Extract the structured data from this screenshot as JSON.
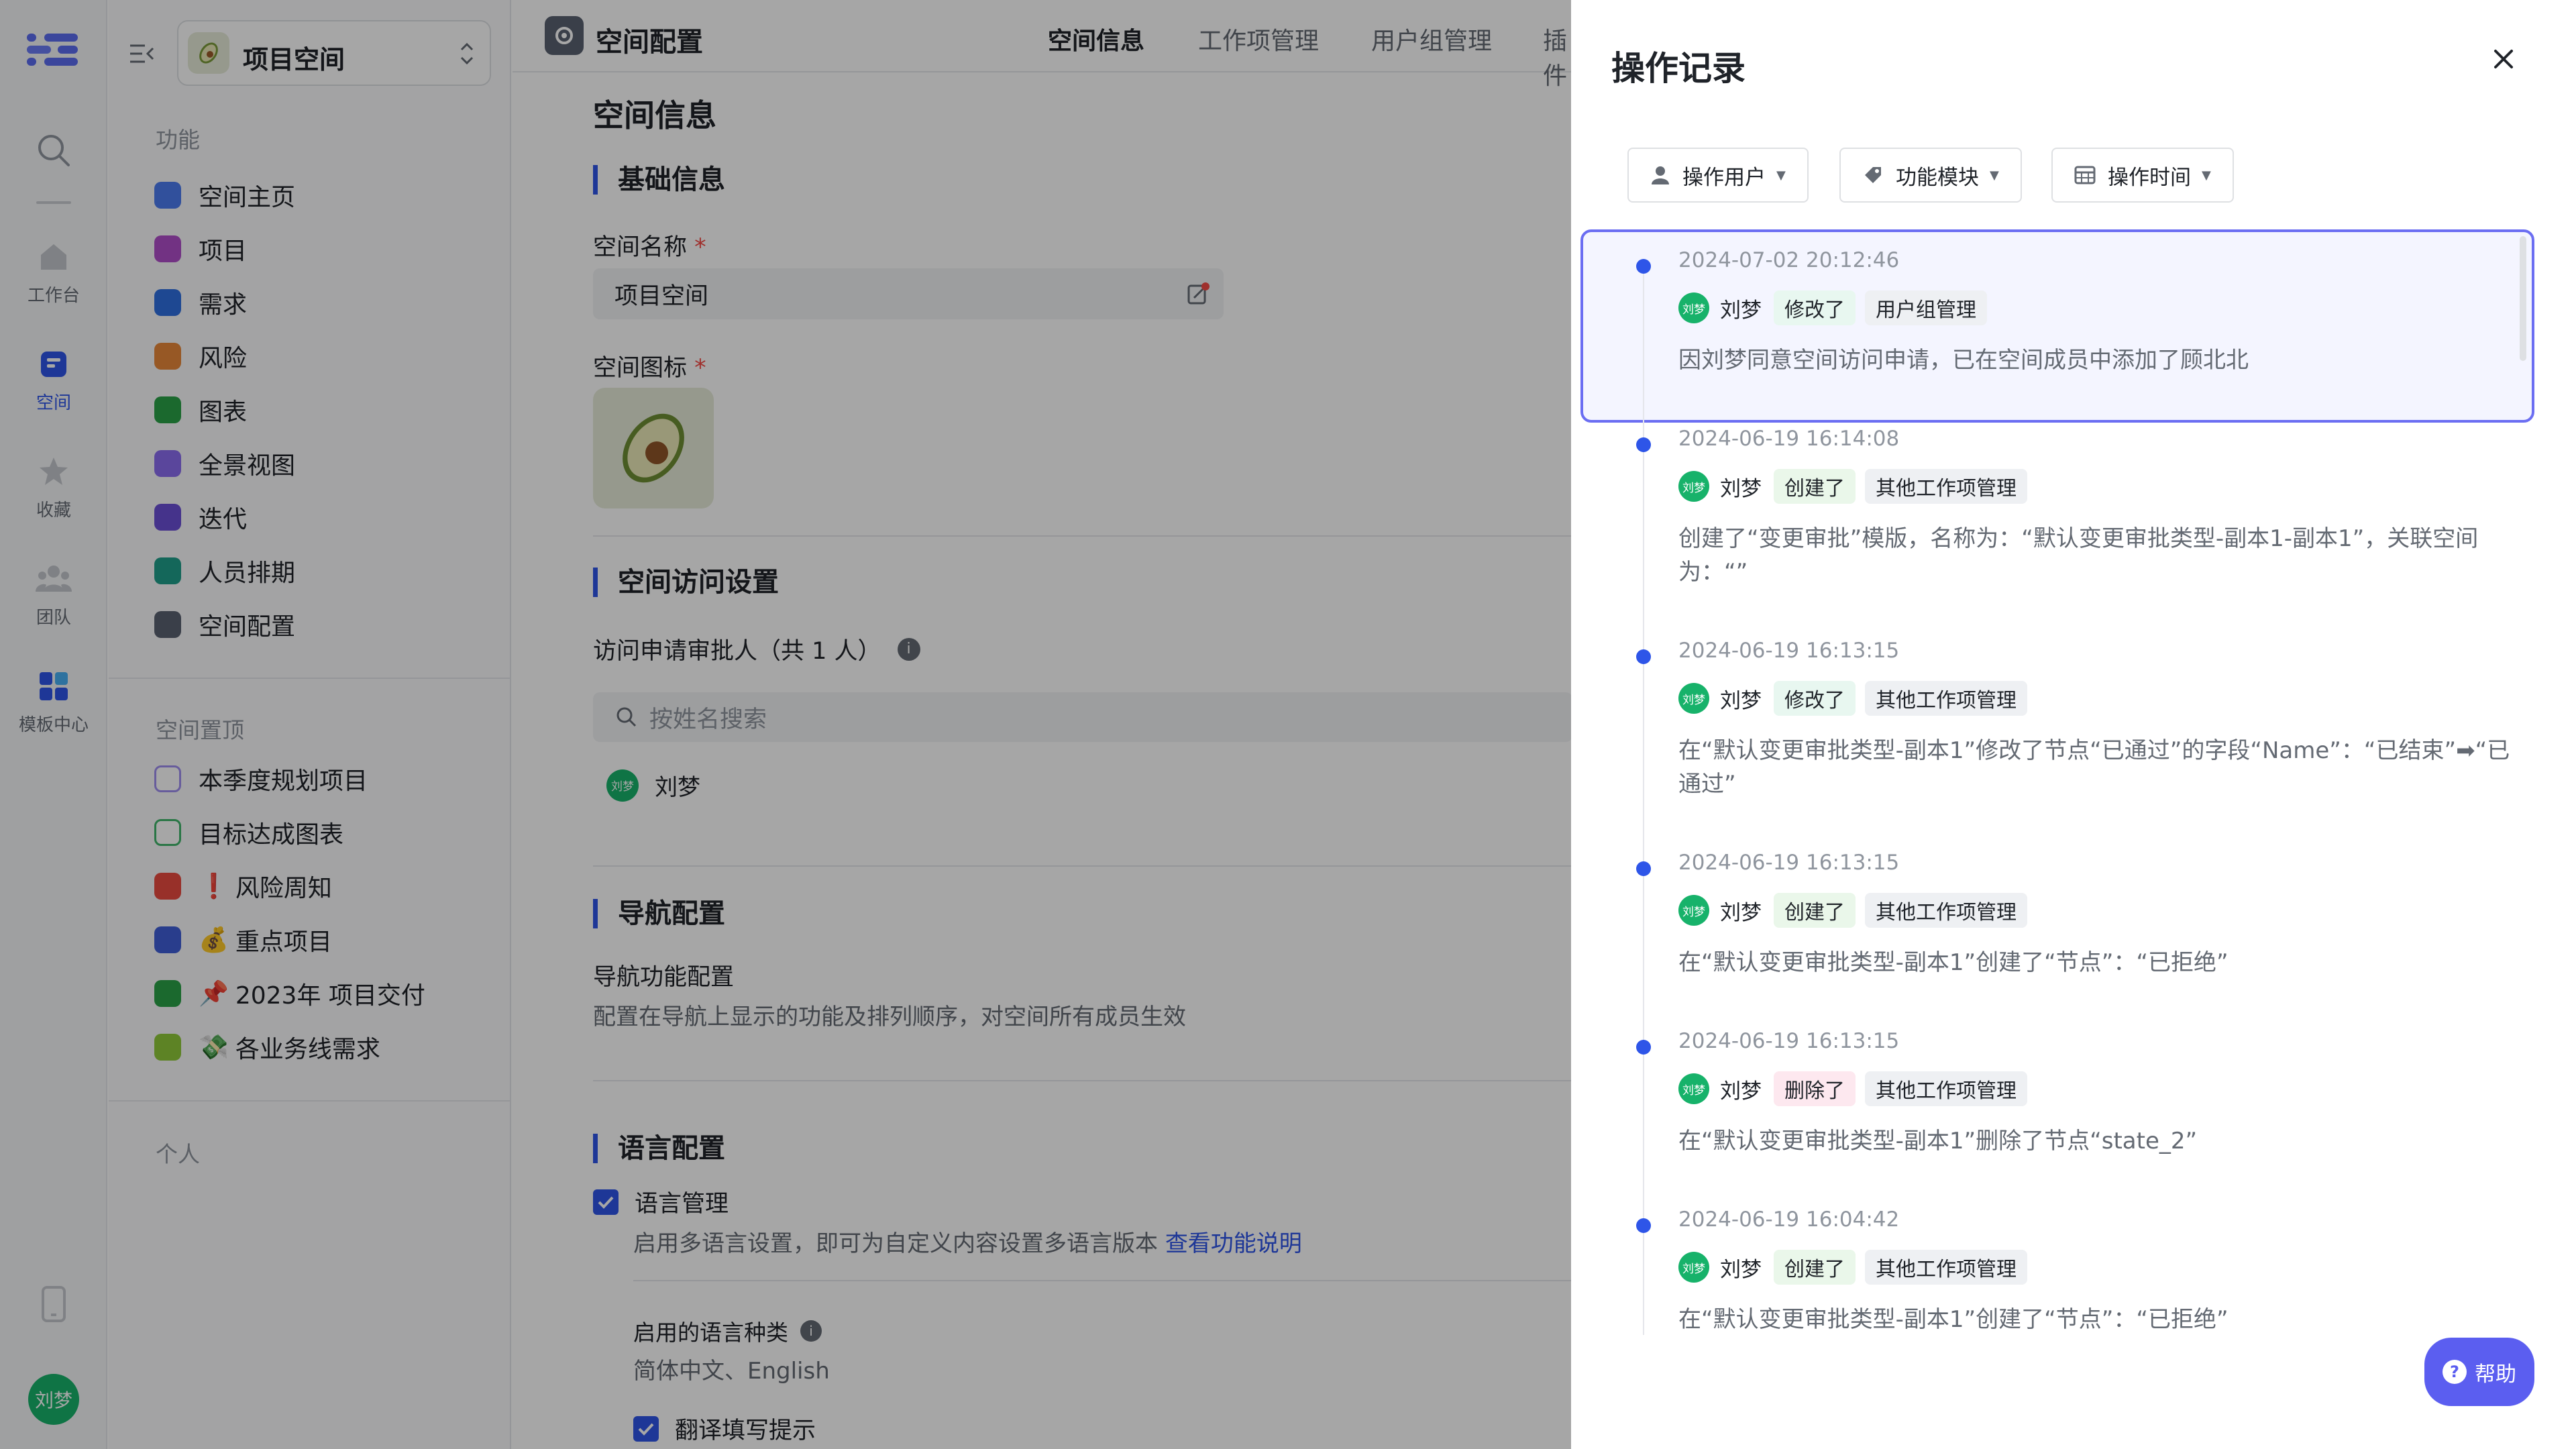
{
  "rail": {
    "items": [
      {
        "label": "工作台",
        "icon": "home-icon"
      },
      {
        "label": "空间",
        "icon": "space-icon"
      },
      {
        "label": "收藏",
        "icon": "star-icon"
      },
      {
        "label": "团队",
        "icon": "team-icon"
      },
      {
        "label": "模板中心",
        "icon": "template-icon"
      }
    ],
    "user_avatar": "刘梦"
  },
  "sidebar": {
    "space_name": "项目空间",
    "section_functions": "功能",
    "functions": [
      {
        "label": "空间主页",
        "color": "#4c7cf0"
      },
      {
        "label": "项目",
        "color": "#b04ec9"
      },
      {
        "label": "需求",
        "color": "#2e6fe0"
      },
      {
        "label": "风险",
        "color": "#e8883a"
      },
      {
        "label": "图表",
        "color": "#2aa148"
      },
      {
        "label": "全景视图",
        "color": "#8a6cf0"
      },
      {
        "label": "迭代",
        "color": "#6a4fd6"
      },
      {
        "label": "人员排期",
        "color": "#1f9e8a"
      },
      {
        "label": "空间配置",
        "color": "#5a6270"
      }
    ],
    "section_pinned": "空间置顶",
    "pinned": [
      {
        "label": "本季度规划项目",
        "color": "#9e8ef0",
        "emoji": ""
      },
      {
        "label": "目标达成图表",
        "color": "#3fb66a",
        "emoji": ""
      },
      {
        "label": "风险周知",
        "color": "#ea4a3f",
        "emoji": "❗"
      },
      {
        "label": "重点项目",
        "color": "#3f5fd8",
        "emoji": "💰"
      },
      {
        "label": "2023年 项目交付",
        "color": "#2aa148",
        "emoji": "📌"
      },
      {
        "label": "各业务线需求",
        "color": "#8fc93a",
        "emoji": "💸"
      }
    ],
    "section_personal": "个人"
  },
  "main": {
    "header_title": "空间配置",
    "tabs": [
      "空间信息",
      "工作项管理",
      "用户组管理",
      "插件"
    ],
    "page_title": "空间信息",
    "basic_title": "基础信息",
    "name_label": "空间名称",
    "name_value": "项目空间",
    "icon_label": "空间图标",
    "access_title": "空间访问设置",
    "approver_label": "访问申请审批人（共 1 人）",
    "search_placeholder": "按姓名搜索",
    "approver_name": "刘梦",
    "nav_title": "导航配置",
    "nav_sub": "导航功能配置",
    "nav_desc": "配置在导航上显示的功能及排列顺序，对空间所有成员生效",
    "lang_title": "语言配置",
    "lang_mgmt": "语言管理",
    "lang_desc": "启用多语言设置，即可为自定义内容设置多语言版本",
    "lang_link": "查看功能说明",
    "lang_kinds_label": "启用的语言种类",
    "lang_kinds_value": "简体中文、English",
    "translate_hint": "翻译填写提示"
  },
  "drawer": {
    "title": "操作记录",
    "filters": [
      "操作用户",
      "功能模块",
      "操作时间"
    ],
    "entries": [
      {
        "time": "2024-07-02 20:12:46",
        "user": "刘梦",
        "action": "修改了",
        "module": "用户组管理",
        "desc": "因刘梦同意空间访问申请，已在空间成员中添加了顾北北"
      },
      {
        "time": "2024-06-19 16:14:08",
        "user": "刘梦",
        "action": "创建了",
        "module": "其他工作项管理",
        "desc": "创建了“变更审批”模版，名称为：“默认变更审批类型-副本1-副本1”，关联空间为：“”"
      },
      {
        "time": "2024-06-19 16:13:15",
        "user": "刘梦",
        "action": "修改了",
        "module": "其他工作项管理",
        "desc": "在“默认变更审批类型-副本1”修改了节点“已通过”的字段“Name”：“已结束”➡“已通过”"
      },
      {
        "time": "2024-06-19 16:13:15",
        "user": "刘梦",
        "action": "创建了",
        "module": "其他工作项管理",
        "desc": "在“默认变更审批类型-副本1”创建了“节点”：“已拒绝”"
      },
      {
        "time": "2024-06-19 16:13:15",
        "user": "刘梦",
        "action": "删除了",
        "module": "其他工作项管理",
        "desc": "在“默认变更审批类型-副本1”删除了节点“state_2”"
      },
      {
        "time": "2024-06-19 16:04:42",
        "user": "刘梦",
        "action": "创建了",
        "module": "其他工作项管理",
        "desc": "在“默认变更审批类型-副本1”创建了“节点”：“已拒绝”"
      }
    ],
    "help_label": "帮助"
  }
}
